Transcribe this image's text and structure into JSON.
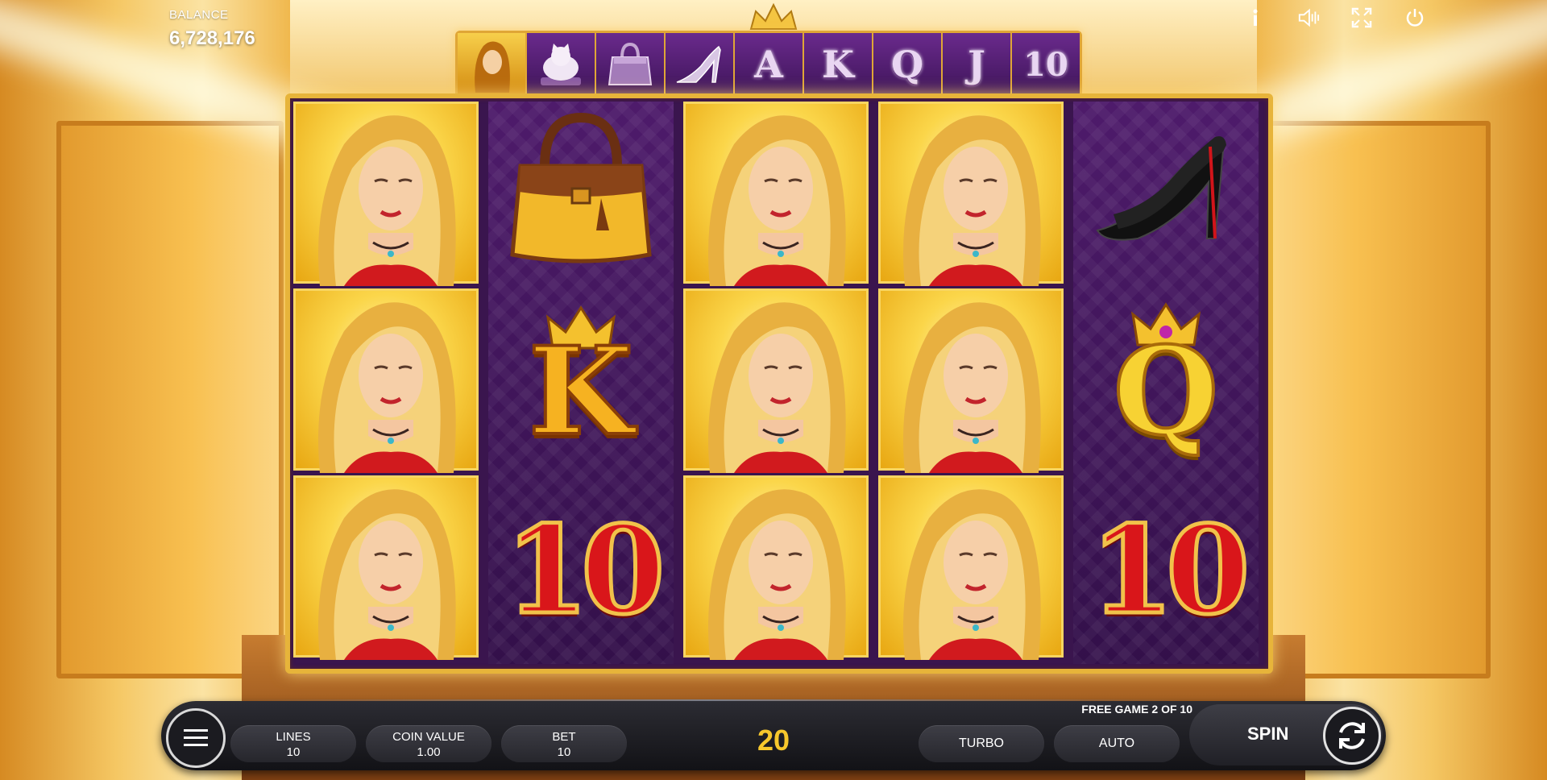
{
  "hud": {
    "balance_label": "BALANCE",
    "balance_value": "6,728,176",
    "icons": [
      "info-icon",
      "sound-icon",
      "fullscreen-icon",
      "power-icon"
    ]
  },
  "paytable": [
    {
      "name": "woman-symbol"
    },
    {
      "name": "cat-symbol"
    },
    {
      "name": "handbag-symbol"
    },
    {
      "name": "heels-symbol"
    },
    {
      "name": "a-symbol",
      "label": "A"
    },
    {
      "name": "k-symbol",
      "label": "K"
    },
    {
      "name": "q-symbol",
      "label": "Q"
    },
    {
      "name": "j-symbol",
      "label": "J"
    },
    {
      "name": "ten-symbol",
      "label": "10"
    }
  ],
  "reels": [
    [
      "woman",
      "woman",
      "woman"
    ],
    [
      "handbag",
      "K",
      "10"
    ],
    [
      "woman",
      "woman",
      "woman"
    ],
    [
      "woman",
      "woman",
      "woman"
    ],
    [
      "heels",
      "Q",
      "10"
    ]
  ],
  "symbols": {
    "k": "K",
    "q": "Q",
    "ten": "10"
  },
  "controls": {
    "lines_label": "LINES",
    "lines_value": "10",
    "coin_value_label": "COIN VALUE",
    "coin_value": "1.00",
    "bet_label": "BET",
    "bet_value": "10",
    "win_value": "20",
    "free_game_text": "FREE GAME 2 OF 10",
    "turbo_label": "TURBO",
    "auto_label": "AUTO",
    "spin_label": "SPIN"
  },
  "colors": {
    "gold": "#e7b43a",
    "purple": "#3a154e",
    "win": "#f6c72c"
  }
}
